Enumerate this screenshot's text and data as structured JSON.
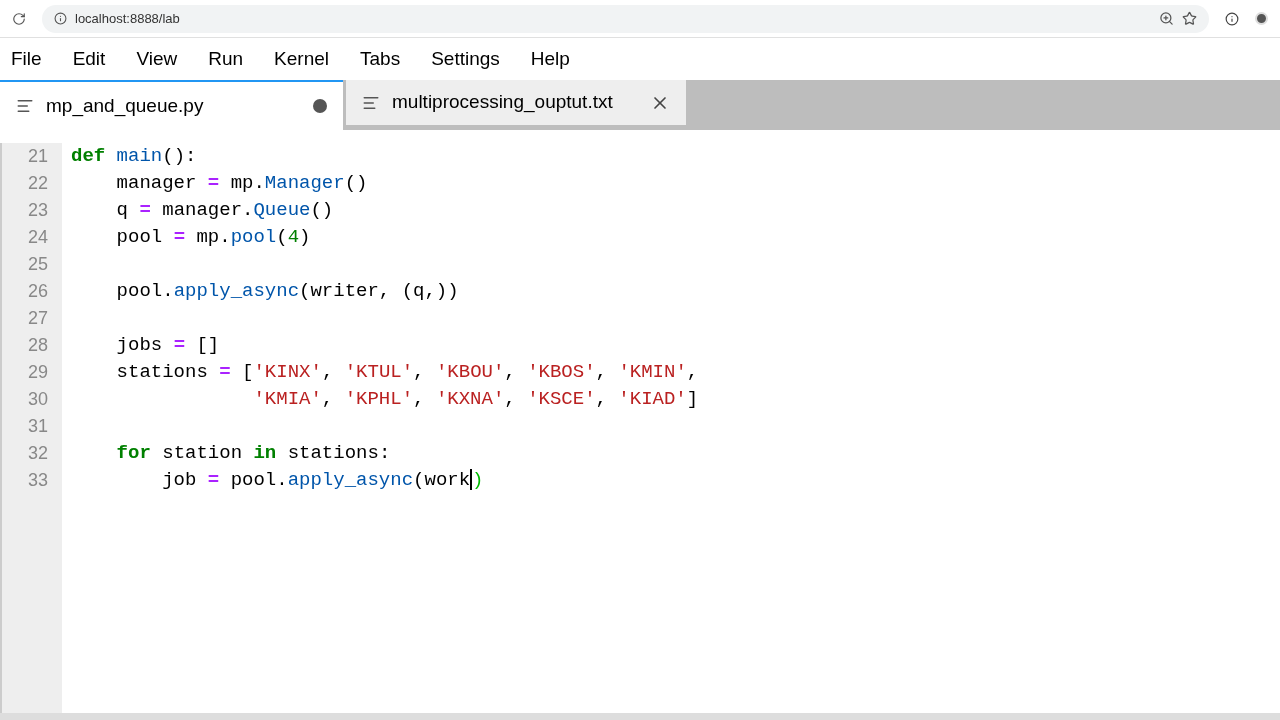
{
  "browser": {
    "url": "localhost:8888/lab"
  },
  "menu": [
    "File",
    "Edit",
    "View",
    "Run",
    "Kernel",
    "Tabs",
    "Settings",
    "Help"
  ],
  "tabs": [
    {
      "label": "mp_and_queue.py",
      "selected": true,
      "modified": true
    },
    {
      "label": "multiprocessing_ouptut.txt",
      "selected": false,
      "modified": false
    }
  ],
  "editor": {
    "lines": [
      {
        "number": "21",
        "tokens": [
          {
            "text": "def",
            "kind": "keyword"
          },
          {
            "text": " main",
            "kind": "name"
          },
          {
            "text": "():",
            "kind": "plain"
          }
        ]
      },
      {
        "number": "22",
        "tokens": [
          {
            "text": "    manager ",
            "kind": "plain"
          },
          {
            "text": "=",
            "kind": "operator"
          },
          {
            "text": " mp.",
            "kind": "plain"
          },
          {
            "text": "Manager",
            "kind": "name"
          },
          {
            "text": "()",
            "kind": "plain"
          }
        ]
      },
      {
        "number": "23",
        "tokens": [
          {
            "text": "    q ",
            "kind": "plain"
          },
          {
            "text": "=",
            "kind": "operator"
          },
          {
            "text": " manager.",
            "kind": "plain"
          },
          {
            "text": "Queue",
            "kind": "name"
          },
          {
            "text": "()",
            "kind": "plain"
          }
        ]
      },
      {
        "number": "24",
        "tokens": [
          {
            "text": "    pool ",
            "kind": "plain"
          },
          {
            "text": "=",
            "kind": "operator"
          },
          {
            "text": " mp.",
            "kind": "plain"
          },
          {
            "text": "pool",
            "kind": "name"
          },
          {
            "text": "(",
            "kind": "plain"
          },
          {
            "text": "4",
            "kind": "number"
          },
          {
            "text": ")",
            "kind": "plain"
          }
        ]
      },
      {
        "number": "25"
      },
      {
        "number": "26",
        "tokens": [
          {
            "text": "    pool.",
            "kind": "plain"
          },
          {
            "text": "apply_async",
            "kind": "name"
          },
          {
            "text": "(writer, (q,))",
            "kind": "plain"
          }
        ]
      },
      {
        "number": "27"
      },
      {
        "number": "28",
        "tokens": [
          {
            "text": "    jobs ",
            "kind": "plain"
          },
          {
            "text": "=",
            "kind": "operator"
          },
          {
            "text": " []",
            "kind": "plain"
          }
        ]
      },
      {
        "number": "29",
        "tokens": [
          {
            "text": "    stations ",
            "kind": "plain"
          },
          {
            "text": "=",
            "kind": "operator"
          },
          {
            "text": " [",
            "kind": "plain"
          },
          {
            "text": "'KINX'",
            "kind": "string"
          },
          {
            "text": ", ",
            "kind": "plain"
          },
          {
            "text": "'KTUL'",
            "kind": "string"
          },
          {
            "text": ", ",
            "kind": "plain"
          },
          {
            "text": "'KBOU'",
            "kind": "string"
          },
          {
            "text": ", ",
            "kind": "plain"
          },
          {
            "text": "'KBOS'",
            "kind": "string"
          },
          {
            "text": ", ",
            "kind": "plain"
          },
          {
            "text": "'KMIN'",
            "kind": "string"
          },
          {
            "text": ",",
            "kind": "plain"
          }
        ]
      },
      {
        "number": "30",
        "tokens": [
          {
            "text": "                'KMIA'",
            "kind": "string"
          },
          {
            "text": ", ",
            "kind": "plain"
          },
          {
            "text": "'KPHL'",
            "kind": "string"
          },
          {
            "text": ", ",
            "kind": "plain"
          },
          {
            "text": "'KXNA'",
            "kind": "string"
          },
          {
            "text": ", ",
            "kind": "plain"
          },
          {
            "text": "'KSCE'",
            "kind": "string"
          },
          {
            "text": ", ",
            "kind": "plain"
          },
          {
            "text": "'KIAD'",
            "kind": "string"
          },
          {
            "text": "]",
            "kind": "plain"
          }
        ]
      },
      {
        "number": "31"
      },
      {
        "number": "32",
        "tokens": [
          {
            "text": "    for",
            "kind": "keyword"
          },
          {
            "text": " station ",
            "kind": "plain"
          },
          {
            "text": "in",
            "kind": "keyword"
          },
          {
            "text": " stations:",
            "kind": "plain"
          }
        ]
      },
      {
        "number": "33",
        "tokens": [
          {
            "text": "        job ",
            "kind": "plain"
          },
          {
            "text": "=",
            "kind": "operator"
          },
          {
            "text": " pool.",
            "kind": "plain"
          },
          {
            "text": "apply_async",
            "kind": "name"
          },
          {
            "text": "(work",
            "kind": "plain"
          },
          {
            "kind": "caret"
          },
          {
            "text": ")",
            "kind": "match"
          }
        ]
      }
    ]
  }
}
